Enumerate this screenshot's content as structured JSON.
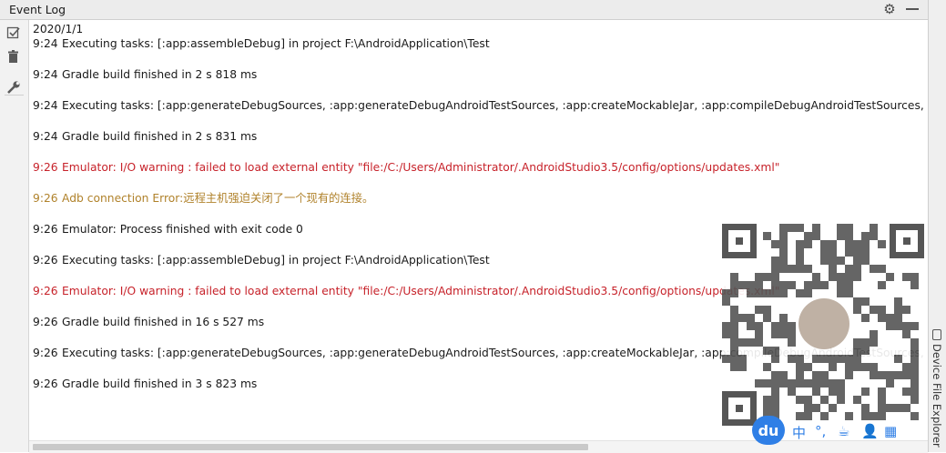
{
  "window": {
    "title": "Event Log"
  },
  "side_panel": {
    "label": "Device File Explorer"
  },
  "log": {
    "date": "2020/1/1",
    "entries": [
      {
        "time": "9:24",
        "text": "Executing tasks: [:app:assembleDebug] in project F:\\AndroidApplication\\Test",
        "level": "info"
      },
      {
        "time": "9:24",
        "text": "Gradle build finished in 2 s 818 ms",
        "level": "info"
      },
      {
        "time": "9:24",
        "text": "Executing tasks: [:app:generateDebugSources, :app:generateDebugAndroidTestSources, :app:createMockableJar, :app:compileDebugAndroidTestSources, :app:con",
        "level": "info"
      },
      {
        "time": "9:24",
        "text": "Gradle build finished in 2 s 831 ms",
        "level": "info"
      },
      {
        "time": "9:26",
        "text": "Emulator: I/O warning : failed to load external entity \"file:/C:/Users/Administrator/.AndroidStudio3.5/config/options/updates.xml\"",
        "level": "error"
      },
      {
        "time": "9:26",
        "text": "Adb connection Error:远程主机强迫关闭了一个现有的连接。",
        "level": "warn"
      },
      {
        "time": "9:26",
        "text": "Emulator: Process finished with exit code 0",
        "level": "info"
      },
      {
        "time": "9:26",
        "text": "Executing tasks: [:app:assembleDebug] in project F:\\AndroidApplication\\Test",
        "level": "info"
      },
      {
        "time": "9:26",
        "text": "Emulator: I/O warning : failed to load external entity \"file:/C:/Users/Administrator/.AndroidStudio3.5/config/options/updates.xml\"",
        "level": "error"
      },
      {
        "time": "9:26",
        "text": "Gradle build finished in 16 s 527 ms",
        "level": "info"
      },
      {
        "time": "9:26",
        "text": "Executing tasks: [:app:generateDebugSources, :app:generateDebugAndroidTestSources, :app:createMockableJar, :app:compileDebugAndroidTestSources, :app:con",
        "level": "info"
      },
      {
        "time": "9:26",
        "text": "Gradle build finished in 3 s 823 ms",
        "level": "info"
      }
    ]
  },
  "colors": {
    "info": "#1a1a1a",
    "error": "#c7222a",
    "warn": "#b0822b"
  },
  "overlay": {
    "badge": "du",
    "ime_items": [
      "中",
      "°,",
      "☕",
      "👤",
      "▦"
    ]
  },
  "icons": [
    "settings-icon",
    "minimize-icon",
    "mark-all-read-icon",
    "trash-icon",
    "wrench-icon",
    "device-icon"
  ]
}
